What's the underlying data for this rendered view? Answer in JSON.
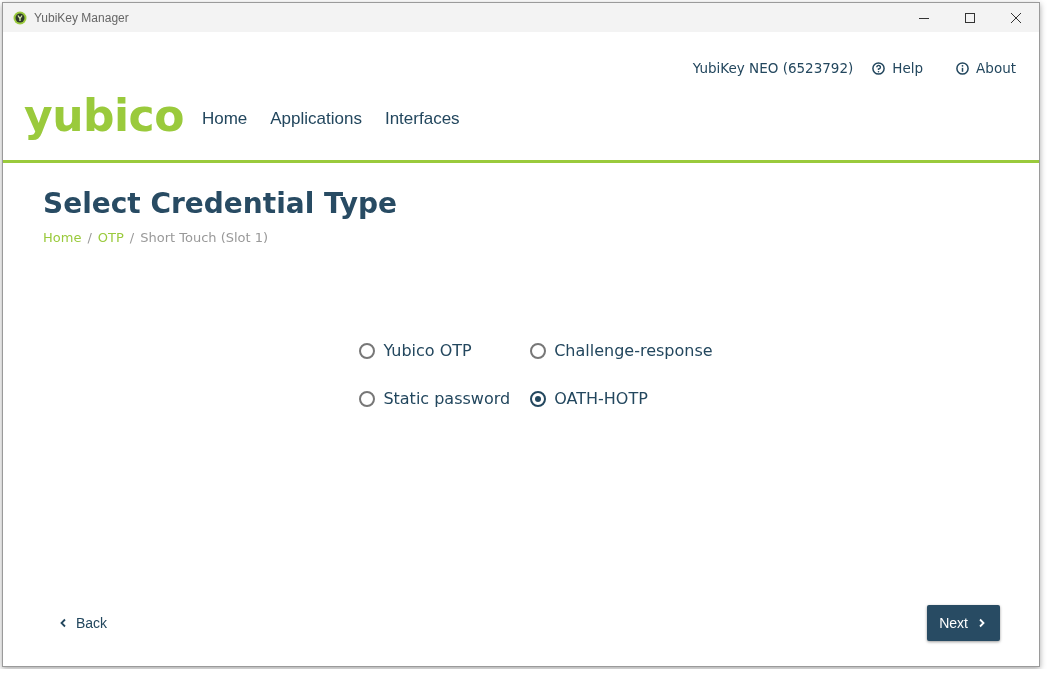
{
  "window": {
    "title": "YubiKey Manager"
  },
  "header": {
    "device": "YubiKey NEO (6523792)",
    "links": [
      {
        "label": "Help"
      },
      {
        "label": "About"
      }
    ]
  },
  "logo": "yubico",
  "nav": [
    {
      "label": "Home"
    },
    {
      "label": "Applications"
    },
    {
      "label": "Interfaces"
    }
  ],
  "page": {
    "title": "Select Credential Type",
    "breadcrumb": [
      {
        "label": "Home",
        "link": true,
        "separator": "/"
      },
      {
        "label": "OTP",
        "link": true,
        "separator": "/"
      },
      {
        "label": "Short Touch (Slot 1)",
        "link": false
      }
    ]
  },
  "options": [
    {
      "label": "Yubico OTP",
      "selected": false
    },
    {
      "label": "Challenge-response",
      "selected": false
    },
    {
      "label": "Static password",
      "selected": false
    },
    {
      "label": "OATH-HOTP",
      "selected": true
    }
  ],
  "footer": {
    "back": "Back",
    "next": "Next"
  }
}
